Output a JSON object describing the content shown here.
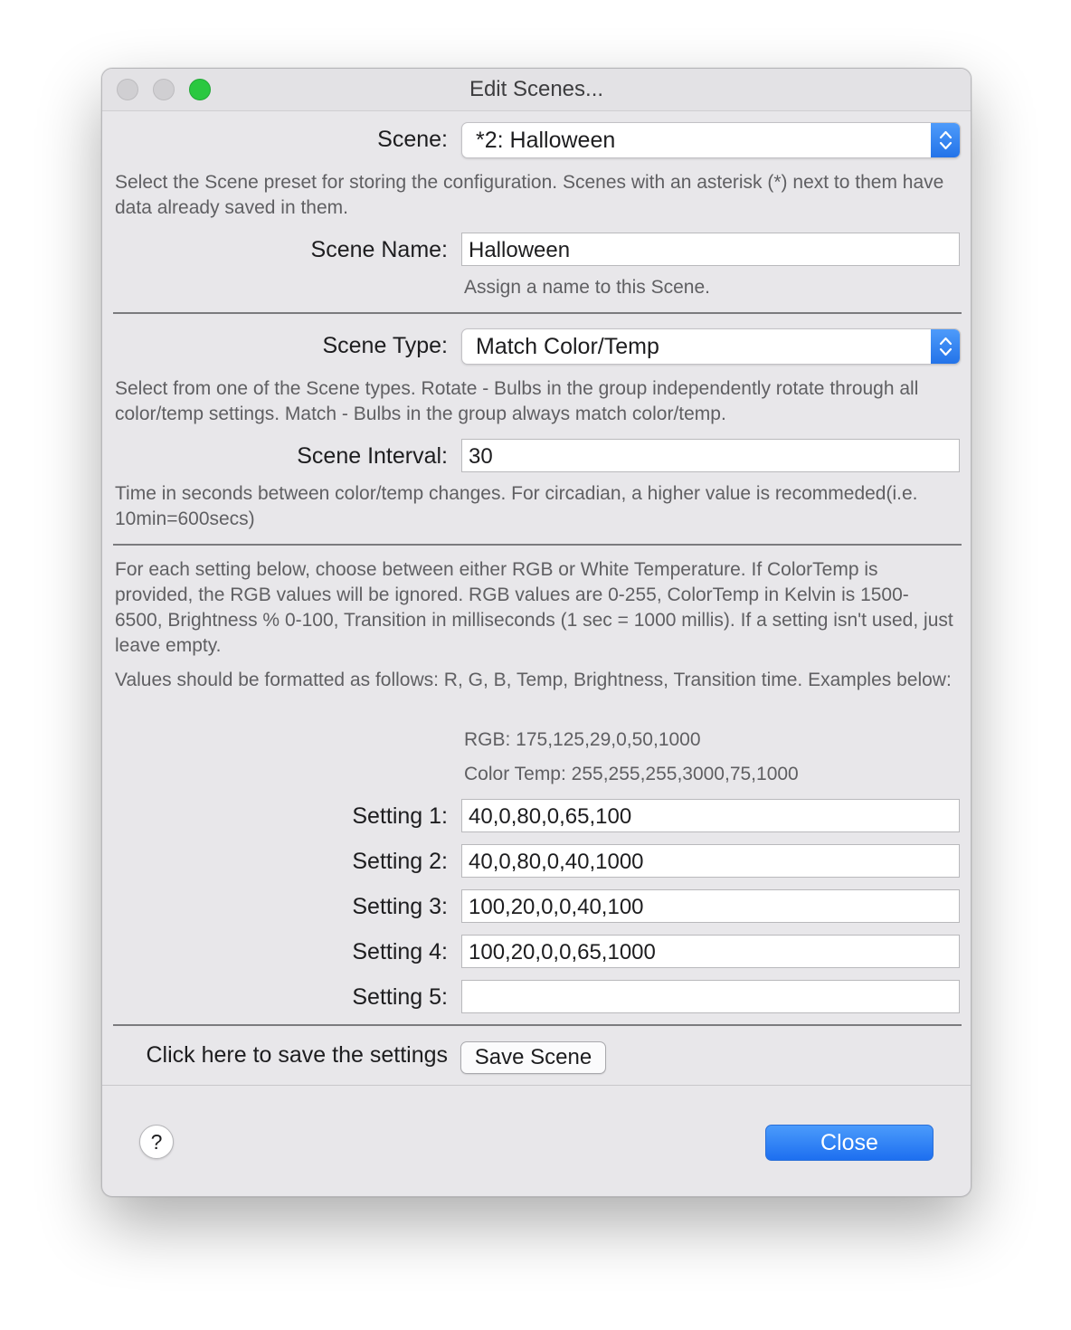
{
  "window": {
    "title": "Edit Scenes..."
  },
  "scene": {
    "label": "Scene:",
    "selected": "*2: Halloween",
    "help": "Select the Scene preset for storing the configuration. Scenes with an asterisk (*) next to them have data already saved in them."
  },
  "scene_name": {
    "label": "Scene Name:",
    "value": "Halloween",
    "help": "Assign a name to this Scene."
  },
  "scene_type": {
    "label": "Scene Type:",
    "selected": "Match Color/Temp",
    "help": "Select from one of the Scene types. Rotate - Bulbs in the group independently rotate through all color/temp settings. Match - Bulbs in the group always match color/temp."
  },
  "scene_interval": {
    "label": "Scene Interval:",
    "value": "30",
    "help": "Time in seconds between color/temp changes. For circadian, a higher value is recommeded(i.e. 10min=600secs)"
  },
  "settings_info": {
    "paragraph1": "For each setting below, choose between either RGB or White Temperature. If ColorTemp is provided, the RGB values will be ignored. RGB values are 0-255, ColorTemp in Kelvin is 1500-6500, Brightness % 0-100, Transition in milliseconds (1 sec = 1000 millis). If a setting isn't used, just leave empty.",
    "paragraph2": "Values should be formatted as follows: R, G, B, Temp, Brightness, Transition time. Examples below:",
    "example_rgb": "RGB: 175,125,29,0,50,1000",
    "example_temp": "Color Temp: 255,255,255,3000,75,1000"
  },
  "settings": [
    {
      "label": "Setting 1:",
      "value": "40,0,80,0,65,100"
    },
    {
      "label": "Setting 2:",
      "value": "40,0,80,0,40,1000"
    },
    {
      "label": "Setting 3:",
      "value": "100,20,0,0,40,100"
    },
    {
      "label": "Setting 4:",
      "value": "100,20,0,0,65,1000"
    },
    {
      "label": "Setting 5:",
      "value": ""
    }
  ],
  "save": {
    "label": "Click here to save the settings",
    "button": "Save Scene"
  },
  "footer": {
    "help_button": "?",
    "close_button": "Close"
  },
  "colors": {
    "accent": "#2272e8",
    "zoom_button": "#2ac840",
    "window_bg": "#e8e7ea"
  },
  "icons": [
    "help-icon",
    "updown-chevron-icon"
  ]
}
